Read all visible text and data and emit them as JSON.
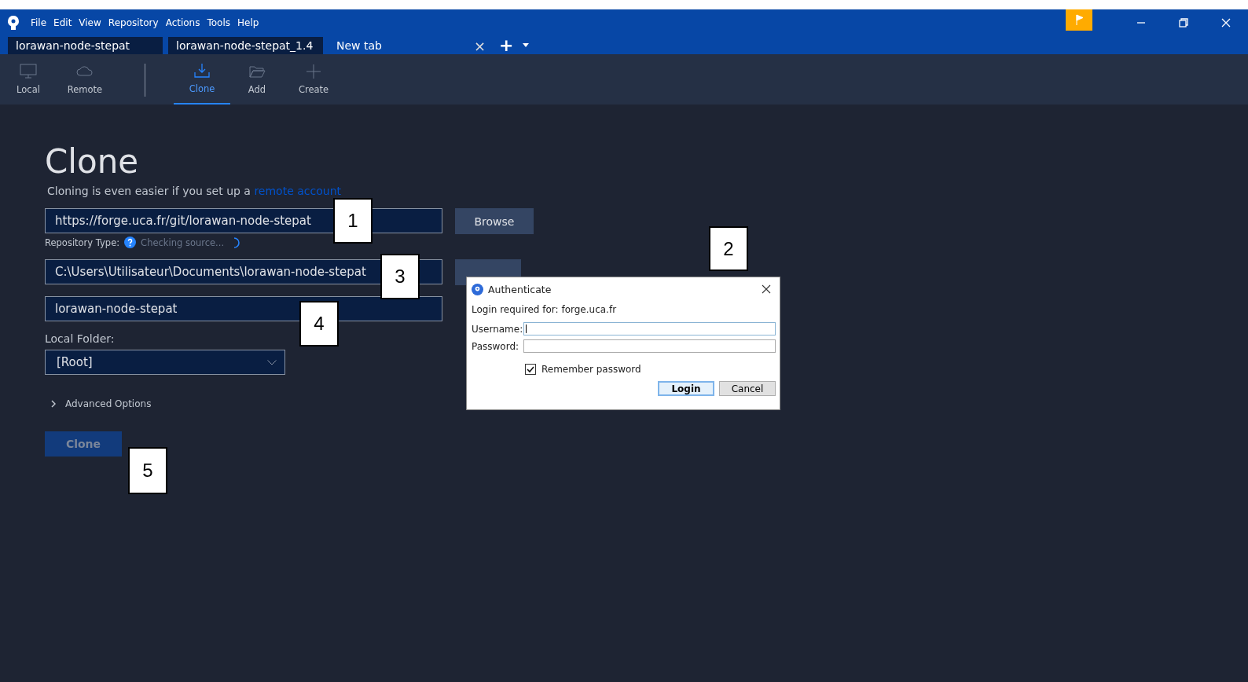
{
  "menu": [
    "File",
    "Edit",
    "View",
    "Repository",
    "Actions",
    "Tools",
    "Help"
  ],
  "tabs": [
    {
      "label": "lorawan-node-stepat",
      "selected": false
    },
    {
      "label": "lorawan-node-stepat_1.4",
      "selected": false
    },
    {
      "label": "New tab",
      "selected": true,
      "close": "×"
    }
  ],
  "tab_add": "+",
  "toolbar": [
    {
      "label": "Local",
      "selected": false
    },
    {
      "label": "Remote",
      "selected": false
    },
    {
      "label": "Clone",
      "selected": true
    },
    {
      "label": "Add",
      "selected": false
    },
    {
      "label": "Create",
      "selected": false
    }
  ],
  "clone": {
    "title": "Clone",
    "subtitle": "Cloning is even easier if you set up a",
    "link": "remote account",
    "url": "https://forge.uca.fr/git/lorawan-node-stepat",
    "browse": "Browse",
    "repo_type_label": "Repository Type:",
    "repo_type_status": "Checking source...",
    "path": "C:\\Users\\Utilisateur\\Documents\\lorawan-node-stepat",
    "name": "lorawan-node-stepat",
    "local_folder_label": "Local Folder:",
    "local_folder": "[Root]",
    "advanced": "Advanced Options",
    "advanced_expanded": false,
    "button": "Clone"
  },
  "dialog": {
    "title": "Authenticate",
    "message": "Login required for: forge.uca.fr",
    "username_label": "Username:",
    "password_label": "Password:",
    "remember": "Remember password",
    "remember_checked": true,
    "login": "Login",
    "cancel": "Cancel"
  },
  "callouts": [
    "1",
    "2",
    "3",
    "4",
    "5"
  ]
}
